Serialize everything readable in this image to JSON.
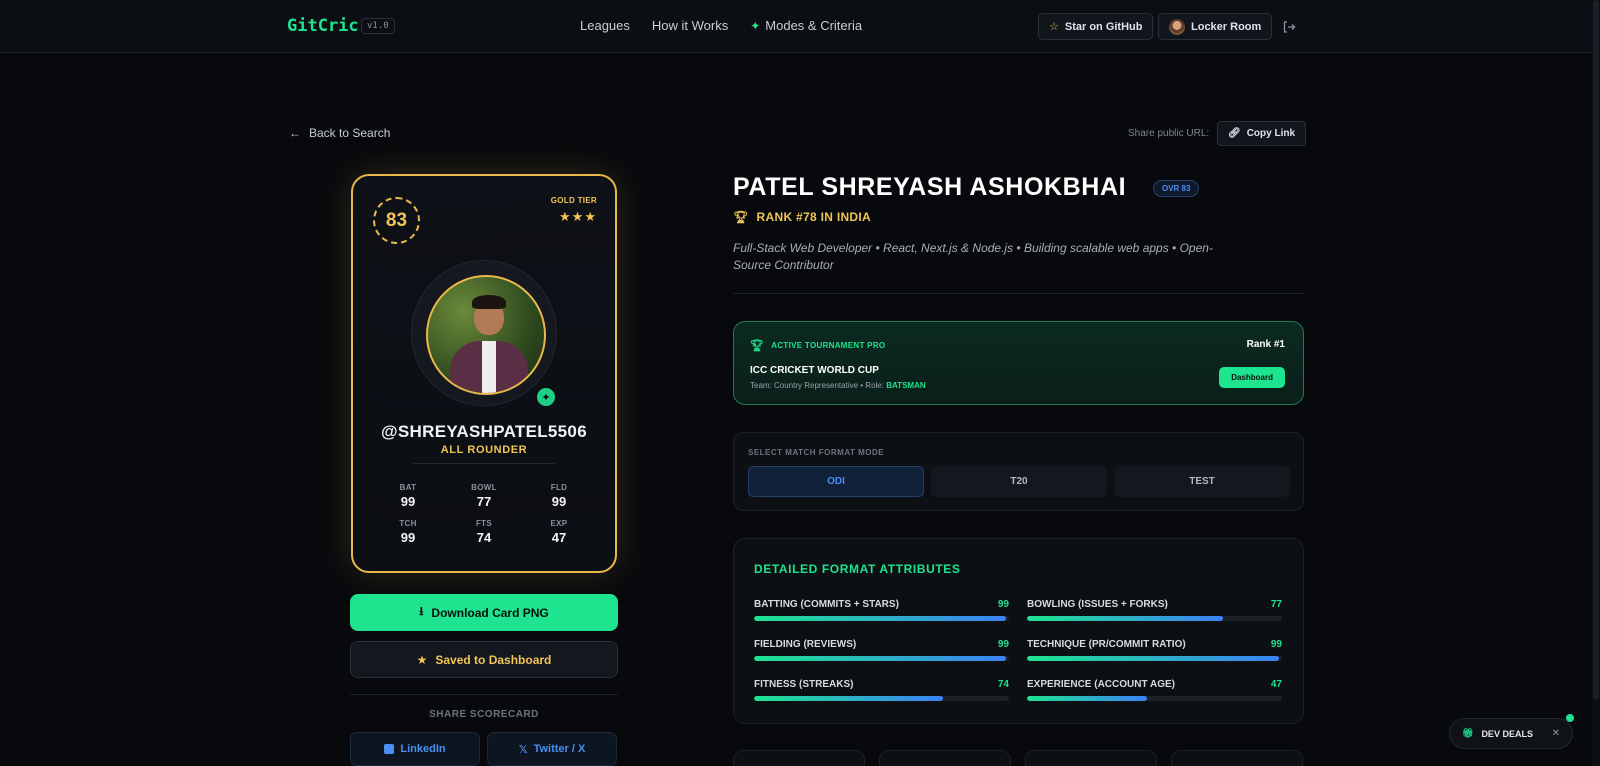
{
  "nav": {
    "logo": "GitCric",
    "version": "v1.0",
    "links": [
      "Leagues",
      "How it Works"
    ],
    "modes": "Modes & Criteria",
    "star_label": "Star on GitHub",
    "locker_label": "Locker Room"
  },
  "top": {
    "back_label": "Back to Search",
    "share_label": "Share public URL:",
    "copy_label": "Copy Link"
  },
  "card": {
    "ovr": "83",
    "tier": "GOLD TIER",
    "stars": "★★★",
    "handle": "@SHREYASHPATEL5506",
    "role": "ALL ROUNDER",
    "stats": [
      {
        "label": "BAT",
        "value": "99"
      },
      {
        "label": "BOWL",
        "value": "77"
      },
      {
        "label": "FLD",
        "value": "99"
      },
      {
        "label": "TCH",
        "value": "99"
      },
      {
        "label": "FTS",
        "value": "74"
      },
      {
        "label": "EXP",
        "value": "47"
      }
    ]
  },
  "actions": {
    "download_label": "Download Card PNG",
    "saved_label": "Saved to Dashboard",
    "share_scorecard": "SHARE SCORECARD",
    "linkedin": "LinkedIn",
    "twitter": "Twitter / X"
  },
  "profile": {
    "name": "PATEL SHREYASH ASHOKBHAI",
    "ovr_badge": "OVR 83",
    "rank": "RANK #78 IN INDIA",
    "bio": "Full-Stack Web Developer • React, Next.js & Node.js • Building scalable web apps • Open-Source Contributor"
  },
  "tournament": {
    "label": "ACTIVE TOURNAMENT PRO",
    "rank": "Rank #1",
    "name": "ICC CRICKET WORLD CUP",
    "meta_prefix": "Team: Country Representative • Role:",
    "role": "BATSMAN",
    "button": "Dashboard"
  },
  "format": {
    "label": "SELECT MATCH FORMAT MODE",
    "options": [
      "ODI",
      "T20",
      "TEST"
    ],
    "active": "ODI"
  },
  "attributes": {
    "title": "DETAILED FORMAT ATTRIBUTES",
    "items": [
      {
        "label": "BATTING (COMMITS + STARS)",
        "value": "99",
        "pct": 99
      },
      {
        "label": "BOWLING (ISSUES + FORKS)",
        "value": "77",
        "pct": 77
      },
      {
        "label": "FIELDING (REVIEWS)",
        "value": "99",
        "pct": 99
      },
      {
        "label": "TECHNIQUE (PR/COMMIT RATIO)",
        "value": "99",
        "pct": 99
      },
      {
        "label": "FITNESS (STREAKS)",
        "value": "74",
        "pct": 74
      },
      {
        "label": "EXPERIENCE (ACCOUNT AGE)",
        "value": "47",
        "pct": 47
      }
    ]
  },
  "dev_deals": "DEV DEALS",
  "colors": {
    "accent": "#1ee38f",
    "gold": "#e9b84a",
    "blue": "#3b82f6",
    "background": "#07090d"
  }
}
